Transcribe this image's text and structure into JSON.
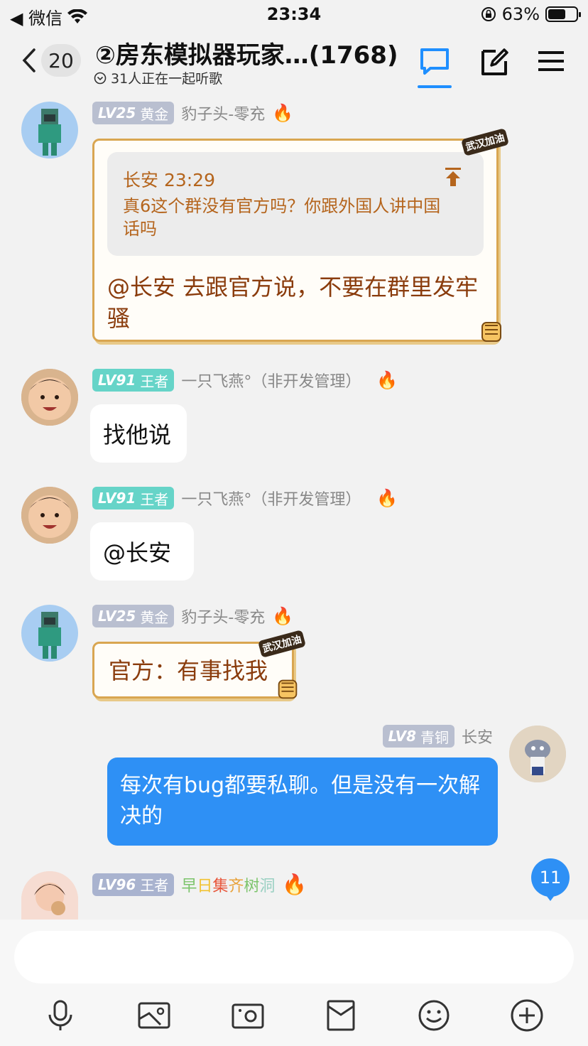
{
  "status_bar": {
    "back_app": "◀ 微信",
    "time": "23:34",
    "battery_pct": "63%",
    "battery_level": 0.63
  },
  "header": {
    "back_count": "20",
    "title": "②房东模拟器玩家…(1768)",
    "subtitle": "31人正在一起听歌"
  },
  "messages": [
    {
      "level": "LV25",
      "rank": "黄金",
      "sender": "豹子头-零充",
      "quote_author_time": "长安 23:29",
      "quote_text": "真6这个群没有官方吗？你跟外国人讲中国话吗",
      "text": "@长安 去跟官方说，不要在群里发牢骚",
      "sticker": "武汉加油"
    },
    {
      "level": "LV91",
      "rank": "王者",
      "sender": "一只飞燕°（非开发管理）",
      "text": "找他说"
    },
    {
      "level": "LV91",
      "rank": "王者",
      "sender": "一只飞燕°（非开发管理）",
      "text": "@长安"
    },
    {
      "level": "LV25",
      "rank": "黄金",
      "sender": "豹子头-零充",
      "text": "官方：有事找我",
      "sticker": "武汉加油"
    },
    {
      "level": "LV8",
      "rank": "青铜",
      "sender": "长安",
      "text": "每次有bug都要私聊。但是没有一次解决的"
    },
    {
      "level": "LV96",
      "rank": "王者",
      "sender_chars": [
        "早",
        "日",
        "集",
        "齐",
        "树",
        "洞"
      ],
      "sender_colors": [
        "#7cc46b",
        "#f2c230",
        "#e8563b",
        "#e8a23b",
        "#7cc46b",
        "#9ad0c2"
      ]
    }
  ],
  "unread_count": "11",
  "input": {
    "placeholder": ""
  },
  "colors": {
    "accent": "#1f8fff",
    "bubble_blue": "#2e90f5",
    "gold_border": "#d9a651"
  },
  "toolbar_icons": [
    "microphone-icon",
    "image-icon",
    "camera-icon",
    "red-packet-icon",
    "emoji-icon",
    "plus-icon"
  ]
}
